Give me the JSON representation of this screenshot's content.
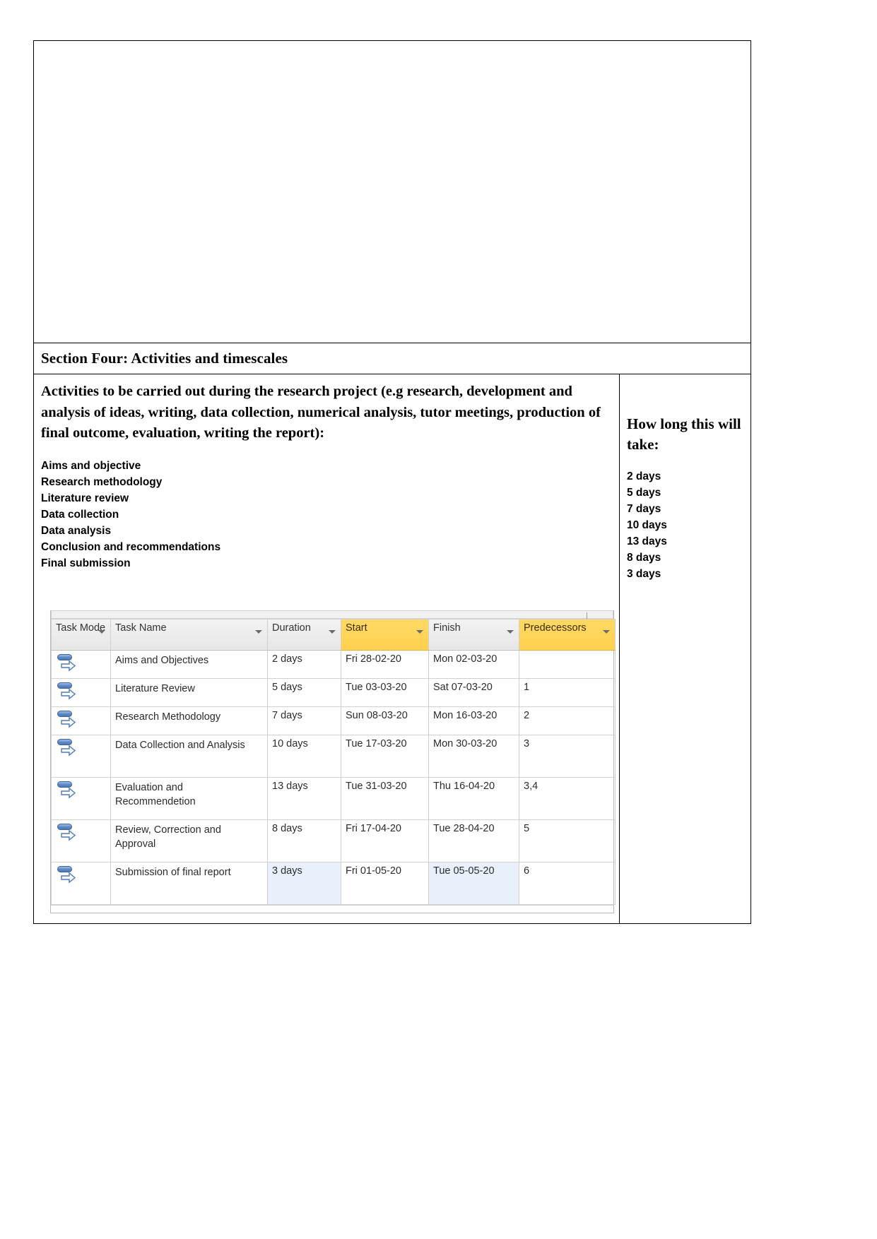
{
  "section": {
    "heading": "Section Four: Activities and timescales"
  },
  "left_column": {
    "intro": "Activities to be carried out during the research project (e.g research, development and analysis of ideas, writing, data collection, numerical analysis, tutor meetings, production of final outcome, evaluation, writing the report):",
    "activities": [
      "Aims and objective",
      "Research methodology",
      "Literature review",
      "Data collection",
      "Data analysis",
      "Conclusion and recommendations",
      "Final submission"
    ]
  },
  "right_column": {
    "title": "How long this will take:",
    "durations": [
      "2 days",
      "5 days",
      "7 days",
      "10 days",
      "13 days",
      "8 days",
      "3 days"
    ]
  },
  "project_table": {
    "headers": [
      "Task Mode",
      "Task Name",
      "Duration",
      "Start",
      "Finish",
      "Predecessors"
    ],
    "highlighted_headers": [
      "Start",
      "Predecessors"
    ],
    "highlight_color": "#ffd04d",
    "selection_color": "#e8f1fb",
    "rows": [
      {
        "mode_icon": "auto-scheduled-icon",
        "name": "Aims and Objectives",
        "duration": "2 days",
        "start": "Fri 28-02-20",
        "finish": "Mon 02-03-20",
        "predecessors": ""
      },
      {
        "mode_icon": "auto-scheduled-icon",
        "name": "Literature Review",
        "duration": "5 days",
        "start": "Tue 03-03-20",
        "finish": "Sat 07-03-20",
        "predecessors": "1"
      },
      {
        "mode_icon": "auto-scheduled-icon",
        "name": "Research Methodology",
        "duration": "7 days",
        "start": "Sun 08-03-20",
        "finish": "Mon 16-03-20",
        "predecessors": "2"
      },
      {
        "mode_icon": "auto-scheduled-icon",
        "name": "Data Collection and Analysis",
        "duration": "10 days",
        "start": "Tue 17-03-20",
        "finish": "Mon 30-03-20",
        "predecessors": "3"
      },
      {
        "mode_icon": "auto-scheduled-icon",
        "name": "Evaluation and Recommendetion",
        "duration": "13 days",
        "start": "Tue 31-03-20",
        "finish": "Thu 16-04-20",
        "predecessors": "3,4"
      },
      {
        "mode_icon": "auto-scheduled-icon",
        "name": "Review, Correction and Approval",
        "duration": "8 days",
        "start": "Fri 17-04-20",
        "finish": "Tue 28-04-20",
        "predecessors": "5"
      },
      {
        "mode_icon": "auto-scheduled-icon",
        "name": "Submission of final report",
        "duration": "3 days",
        "start": "Fri 01-05-20",
        "finish": "Tue 05-05-20",
        "predecessors": "6"
      }
    ]
  }
}
